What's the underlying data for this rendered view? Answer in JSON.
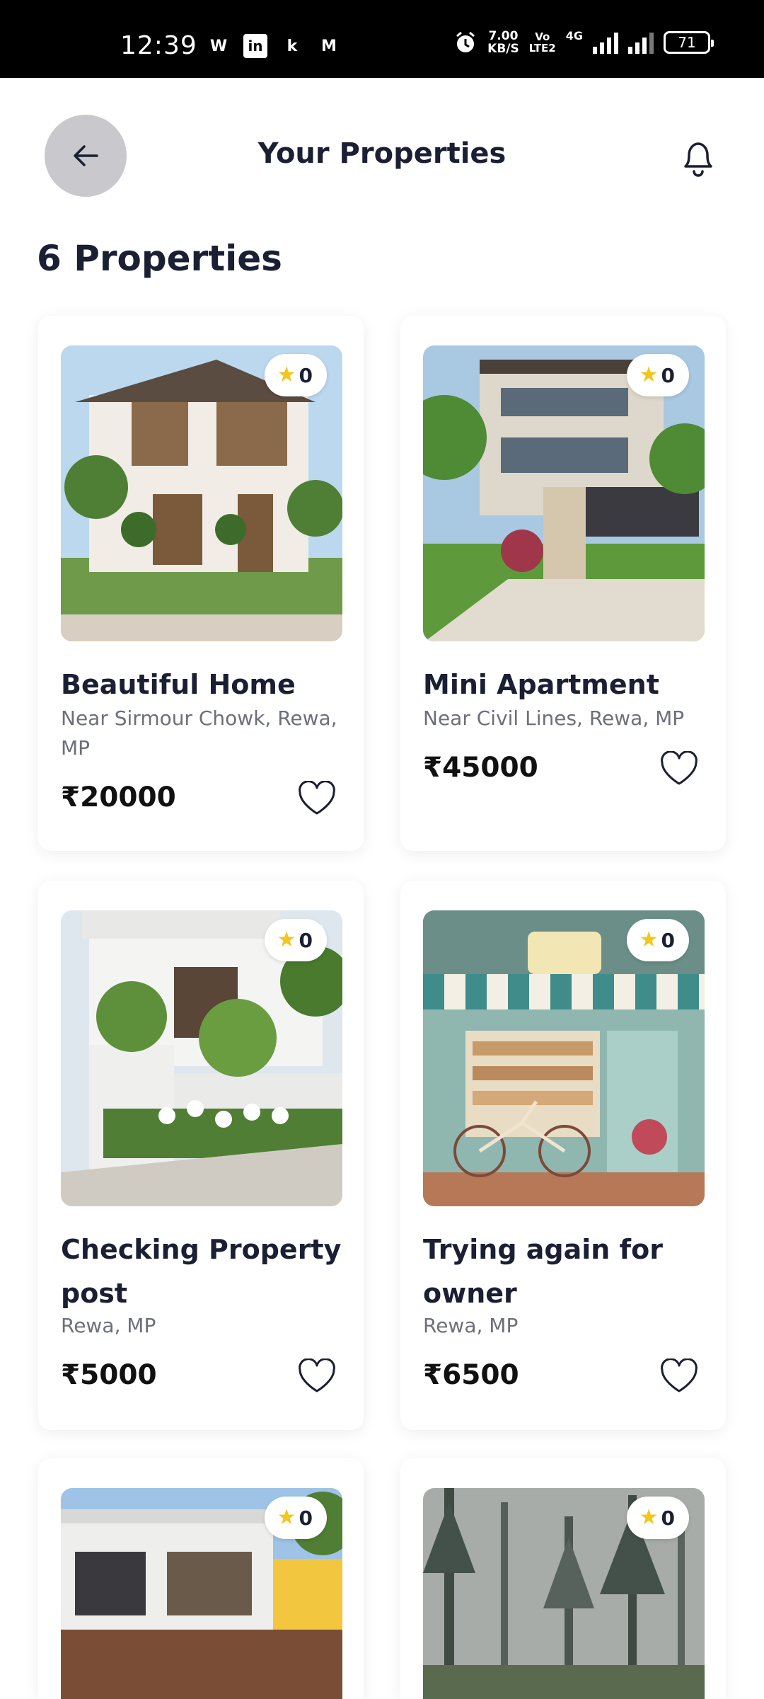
{
  "status_bar": {
    "time": "12:39",
    "apps": [
      "W",
      "in",
      "k",
      "M"
    ],
    "speed": "7.00",
    "speed_unit": "KB/S",
    "volte_top": "Vo",
    "volte_bottom": "LTE2",
    "network": "4G",
    "battery": "71"
  },
  "header": {
    "title": "Your Properties",
    "back_icon": "arrow-left-icon",
    "bell_icon": "bell-icon"
  },
  "summary": {
    "count_label": "6 Properties"
  },
  "properties": [
    {
      "title": "Beautiful Home",
      "location": "Near Sirmour Chowk, Rewa, MP",
      "price": "₹20000",
      "rating": "0"
    },
    {
      "title": "Mini Apartment",
      "location": "Near Civil Lines, Rewa, MP",
      "price": "₹45000",
      "rating": "0"
    },
    {
      "title": "Checking Property post",
      "location": "Rewa, MP",
      "price": "₹5000",
      "rating": "0"
    },
    {
      "title": "Trying again for owner",
      "location": "Rewa, MP",
      "price": "₹6500",
      "rating": "0"
    },
    {
      "rating": "0"
    },
    {
      "rating": "0"
    }
  ],
  "colors": {
    "accent_star": "#f5c518",
    "back_button_bg": "#c9c9cd",
    "title_text": "#1b1f33",
    "secondary_text": "#6d6f7b"
  }
}
